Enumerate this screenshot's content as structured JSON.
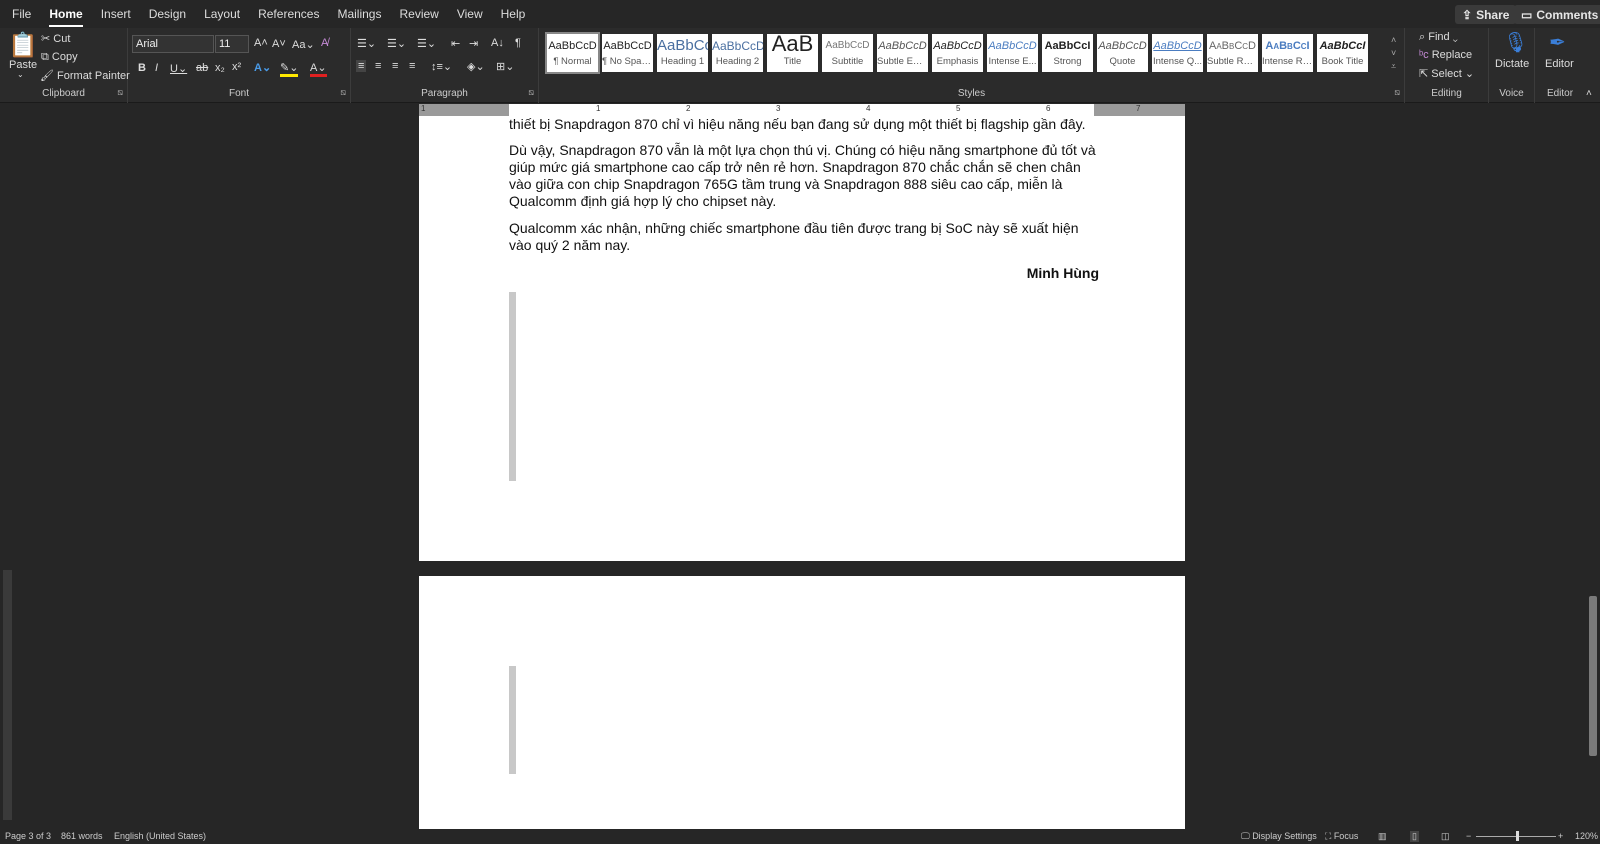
{
  "tabs": [
    "File",
    "Home",
    "Insert",
    "Design",
    "Layout",
    "References",
    "Mailings",
    "Review",
    "View",
    "Help"
  ],
  "share": "Share",
  "comments": "Comments",
  "clipboard": {
    "paste": "Paste",
    "cut": "Cut",
    "copy": "Copy",
    "format_painter": "Format Painter",
    "label": "Clipboard"
  },
  "font": {
    "name": "Arial",
    "size": "11",
    "label": "Font"
  },
  "paragraph": {
    "label": "Paragraph"
  },
  "styles": {
    "label": "Styles",
    "items": [
      {
        "preview": "AaBbCcD",
        "name": "¶ Normal"
      },
      {
        "preview": "AaBbCcD",
        "name": "¶ No Spac..."
      },
      {
        "preview": "AaBbCc",
        "name": "Heading 1"
      },
      {
        "preview": "AaBbCcD",
        "name": "Heading 2"
      },
      {
        "preview": "AaB",
        "name": "Title"
      },
      {
        "preview": "AaBbCcD",
        "name": "Subtitle"
      },
      {
        "preview": "AaBbCcD",
        "name": "Subtle Em..."
      },
      {
        "preview": "AaBbCcD",
        "name": "Emphasis"
      },
      {
        "preview": "AaBbCcD",
        "name": "Intense E..."
      },
      {
        "preview": "AaBbCcI",
        "name": "Strong"
      },
      {
        "preview": "AaBbCcD",
        "name": "Quote"
      },
      {
        "preview": "AaBbCcD",
        "name": "Intense Q..."
      },
      {
        "preview": "AaBbCcD",
        "name": "Subtle Ref..."
      },
      {
        "preview": "AaBbCcI",
        "name": "Intense Re..."
      },
      {
        "preview": "AaBbCcI",
        "name": "Book Title"
      }
    ]
  },
  "editing": {
    "find": "Find",
    "replace": "Replace",
    "select": "Select",
    "label": "Editing"
  },
  "voice": {
    "dictate": "Dictate",
    "label": "Voice"
  },
  "editor": {
    "editor": "Editor",
    "label": "Editor"
  },
  "ruler": [
    "1",
    "1",
    "2",
    "3",
    "4",
    "5",
    "6",
    "7"
  ],
  "document": {
    "p0": "thiết bị Snapdragon 870 chỉ vì hiệu năng nếu bạn đang sử dụng một thiết bị flagship gần đây.",
    "p1": "Dù vậy, Snapdragon 870 vẫn là một lựa chọn thú vị. Chúng có hiệu năng smartphone đủ tốt và giúp mức giá smartphone cao cấp trở nên rẻ hơn. Snapdragon 870 chắc chắn sẽ chen chân vào giữa con chip Snapdragon 765G tầm trung và Snapdragon 888 siêu cao cấp, miễn là Qualcomm định giá hợp lý cho chipset này.",
    "p2": "Qualcomm xác nhận, những chiếc smartphone đầu tiên được trang bị SoC này sẽ xuất hiện vào quý 2 năm nay.",
    "author": "Minh Hùng"
  },
  "status": {
    "page": "Page 3 of 3",
    "words": "861 words",
    "language": "English (United States)",
    "display_settings": "Display Settings",
    "focus": "Focus",
    "zoom": "120%"
  }
}
